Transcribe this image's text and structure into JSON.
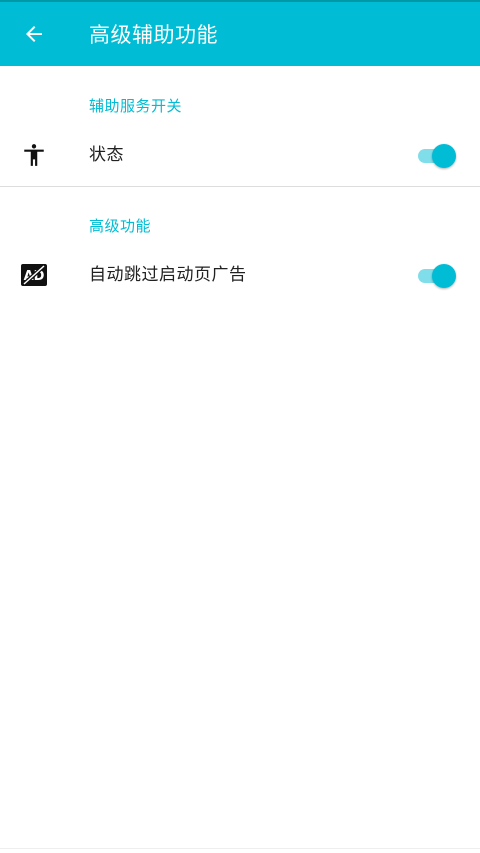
{
  "toolbar": {
    "title": "高级辅助功能",
    "back_icon": "arrow-back-icon",
    "background": "#00bcd4"
  },
  "sections": [
    {
      "title": "辅助服务开关",
      "items": [
        {
          "label": "状态",
          "icon": "accessibility-icon",
          "enabled": true
        }
      ]
    },
    {
      "title": "高级功能",
      "items": [
        {
          "label": "自动跳过启动页广告",
          "icon": "ad-block-icon",
          "enabled": true
        }
      ]
    }
  ],
  "colors": {
    "accent": "#00bcd4",
    "switch_track": "#80deea",
    "text": "#212121"
  }
}
